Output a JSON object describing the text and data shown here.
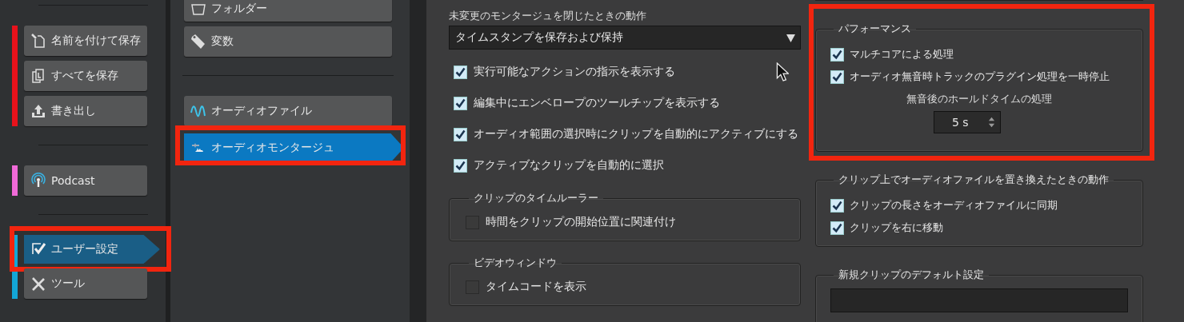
{
  "sidebar": {
    "groups": [
      {
        "color": "#e8121b",
        "items": [
          {
            "label": "名前を付けて保存",
            "selected": false,
            "highlighted": false
          },
          {
            "label": "すべてを保存",
            "selected": false,
            "highlighted": false
          },
          {
            "label": "書き出し",
            "selected": false,
            "highlighted": false
          }
        ]
      },
      {
        "color": "#f06ad8",
        "items": [
          {
            "label": "Podcast",
            "selected": false,
            "highlighted": false
          }
        ]
      },
      {
        "color": "#13a6d6",
        "items": [
          {
            "label": "ユーザー設定",
            "selected": true,
            "highlighted": true
          },
          {
            "label": "ツール",
            "selected": false,
            "highlighted": false
          }
        ]
      }
    ]
  },
  "subnav": {
    "groups": [
      {
        "items": [
          {
            "label": "フォルダー",
            "selected": false,
            "highlighted": false
          },
          {
            "label": "変数",
            "selected": false,
            "highlighted": false
          }
        ]
      },
      {
        "items": [
          {
            "label": "オーディオファイル",
            "selected": false,
            "highlighted": false
          },
          {
            "label": "オーディオモンタージュ",
            "selected": true,
            "highlighted": true
          }
        ]
      }
    ]
  },
  "close_action": {
    "label": "未変更のモンタージュを閉じたときの動作",
    "value": "タイムスタンプを保存および保持"
  },
  "options": [
    {
      "label": "実行可能なアクションの指示を表示する",
      "checked": true
    },
    {
      "label": "編集中にエンベロープのツールチップを表示する",
      "checked": true
    },
    {
      "label": "オーディオ範囲の選択時にクリップを自動的にアクティブにする",
      "checked": true
    },
    {
      "label": "アクティブなクリップを自動的に選択",
      "checked": true
    }
  ],
  "left_groups": [
    {
      "title": "クリップのタイムルーラー",
      "options": [
        {
          "label": "時間をクリップの開始位置に関連付け",
          "checked": false
        }
      ]
    },
    {
      "title": "ビデオウィンドウ",
      "options": [
        {
          "label": "タイムコードを表示",
          "checked": false
        }
      ]
    }
  ],
  "right_groups": [
    {
      "title": "パフォーマンス",
      "highlighted": true,
      "options": [
        {
          "label": "マルチコアによる処理",
          "checked": true
        },
        {
          "label": "オーディオ無音時トラックのプラグイン処理を一時停止",
          "checked": true
        }
      ],
      "hold": {
        "label": "無音後のホールドタイムの処理",
        "value": "5 s"
      }
    },
    {
      "title": "クリップ上でオーディオファイルを置き換えたときの動作",
      "highlighted": false,
      "options": [
        {
          "label": "クリップの長さをオーディオファイルに同期",
          "checked": true
        },
        {
          "label": "クリップを右に移動",
          "checked": true
        }
      ]
    },
    {
      "title": "新規クリップのデフォルト設定",
      "highlighted": false,
      "dropdown": true
    }
  ]
}
